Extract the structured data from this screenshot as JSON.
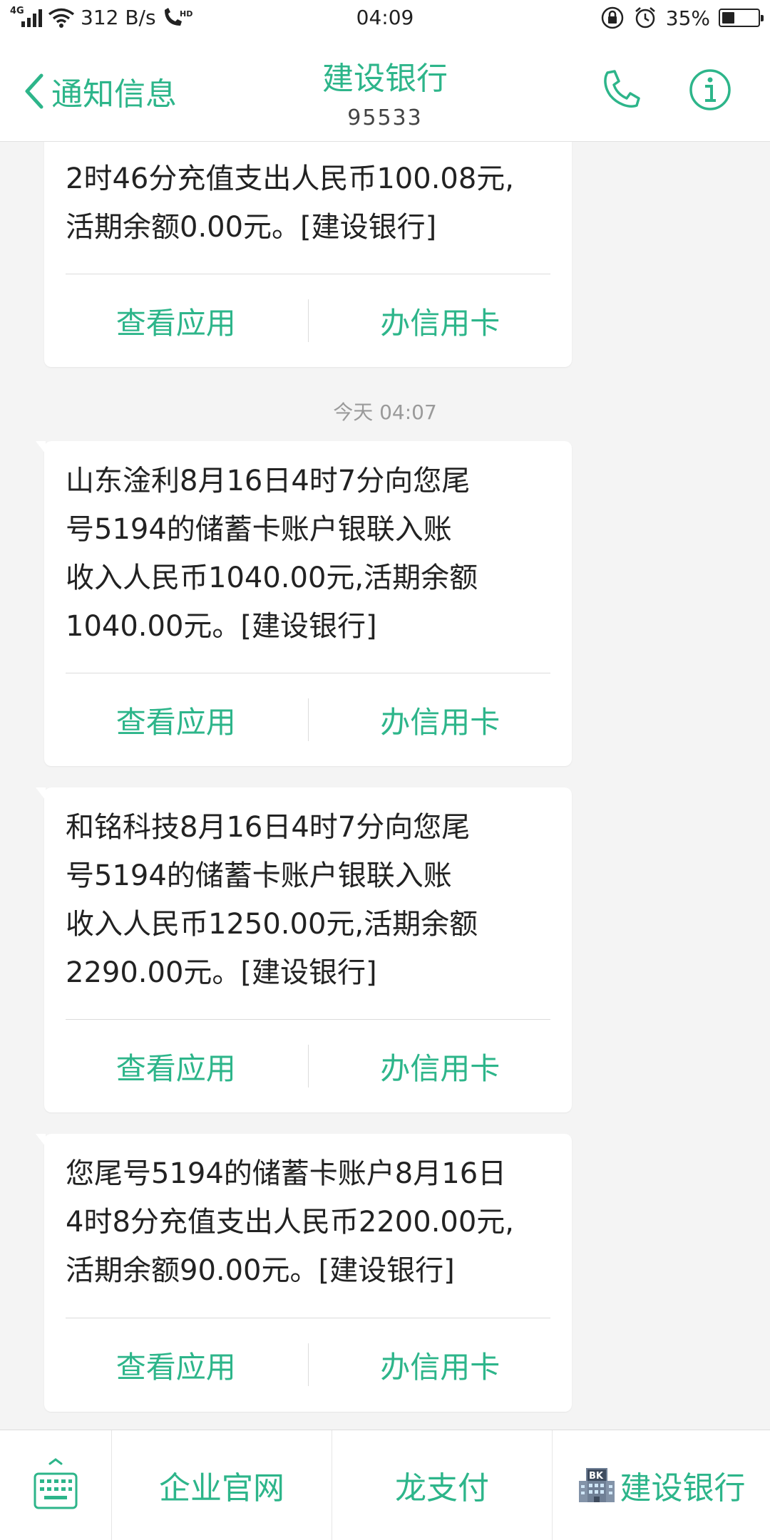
{
  "status_bar": {
    "network_type": "4G",
    "speed": "312 B/s",
    "hd_badge": "HD",
    "time": "04:09",
    "battery_percent": "35%",
    "battery_level": 0.35
  },
  "header": {
    "back_label": "通知信息",
    "title": "建设银行",
    "subtitle": "95533"
  },
  "messages": [
    {
      "text": "2时46分充值支出人民币100.08元,\n活期余额0.00元。[建设银行]",
      "action_view": "查看应用",
      "action_card": "办信用卡"
    },
    {
      "text": "山东淦利8月16日4时7分向您尾\n号5194的储蓄卡账户银联入账\n收入人民币1040.00元,活期余额\n1040.00元。[建设银行]",
      "action_view": "查看应用",
      "action_card": "办信用卡"
    },
    {
      "text": "和铭科技8月16日4时7分向您尾\n号5194的储蓄卡账户银联入账\n收入人民币1250.00元,活期余额\n2290.00元。[建设银行]",
      "action_view": "查看应用",
      "action_card": "办信用卡"
    },
    {
      "text": "您尾号5194的储蓄卡账户8月16日\n4时8分充值支出人民币2200.00元,\n活期余额90.00元。[建设银行]",
      "action_view": "查看应用",
      "action_card": "办信用卡"
    }
  ],
  "timestamp": "今天 04:07",
  "bottom_bar": {
    "menu_1": "企业官网",
    "menu_2": "龙支付",
    "menu_3": "建设银行",
    "menu_3_icon_text": "BK"
  },
  "colors": {
    "accent": "#2db58a",
    "background": "#f4f4f4"
  }
}
